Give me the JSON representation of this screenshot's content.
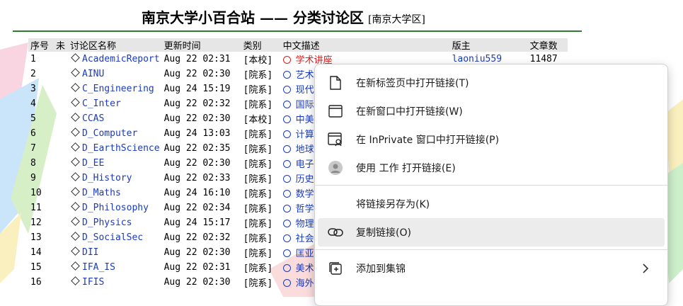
{
  "header": {
    "title": "南京大学小百合站 —— 分类讨论区",
    "subtitle": "[南京大学区]"
  },
  "table": {
    "columns": [
      "序号",
      "未",
      "讨论区名称",
      "更新时间",
      "类别",
      "中文描述",
      "版主",
      "文章数"
    ],
    "rows": [
      {
        "no": "1",
        "name": "AcademicReport",
        "time": "Aug 22 02:31",
        "cat": "[本校]",
        "desc": "学术讲座",
        "owner": "laoniu559",
        "count": "11487",
        "highlight": true
      },
      {
        "no": "2",
        "name": "AINU",
        "time": "Aug 22 02:30",
        "cat": "[院系]",
        "desc": "艺术",
        "owner": "",
        "count": ""
      },
      {
        "no": "3",
        "name": "C_Engineering",
        "time": "Aug 24 15:19",
        "cat": "[院系]",
        "desc": "现代",
        "owner": "",
        "count": ""
      },
      {
        "no": "4",
        "name": "C_Inter",
        "time": "Aug 22 02:32",
        "cat": "[院系]",
        "desc": "国际",
        "owner": "",
        "count": ""
      },
      {
        "no": "5",
        "name": "CCAS",
        "time": "Aug 22 02:30",
        "cat": "[本校]",
        "desc": "中美",
        "owner": "",
        "count": ""
      },
      {
        "no": "6",
        "name": "D_Computer",
        "time": "Aug 24 13:03",
        "cat": "[院系]",
        "desc": "计算",
        "owner": "",
        "count": ""
      },
      {
        "no": "7",
        "name": "D_EarthScience",
        "time": "Aug 22 02:35",
        "cat": "[院系]",
        "desc": "地球",
        "owner": "",
        "count": ""
      },
      {
        "no": "8",
        "name": "D_EE",
        "time": "Aug 22 02:30",
        "cat": "[院系]",
        "desc": "电子",
        "owner": "",
        "count": ""
      },
      {
        "no": "9",
        "name": "D_History",
        "time": "Aug 22 02:33",
        "cat": "[院系]",
        "desc": "历史",
        "owner": "",
        "count": ""
      },
      {
        "no": "10",
        "name": "D_Maths",
        "time": "Aug 24 16:10",
        "cat": "[院系]",
        "desc": "数学",
        "owner": "",
        "count": ""
      },
      {
        "no": "11",
        "name": "D_Philosophy",
        "time": "Aug 22 02:34",
        "cat": "[院系]",
        "desc": "哲学",
        "owner": "",
        "count": ""
      },
      {
        "no": "12",
        "name": "D_Physics",
        "time": "Aug 24 15:17",
        "cat": "[院系]",
        "desc": "物理",
        "owner": "",
        "count": ""
      },
      {
        "no": "13",
        "name": "D_SocialSec",
        "time": "Aug 22 02:32",
        "cat": "[院系]",
        "desc": "社会",
        "owner": "",
        "count": ""
      },
      {
        "no": "14",
        "name": "DII",
        "time": "Aug 22 02:30",
        "cat": "[院系]",
        "desc": "匡亚",
        "owner": "",
        "count": ""
      },
      {
        "no": "15",
        "name": "IFA_IS",
        "time": "Aug 22 02:31",
        "cat": "[院系]",
        "desc": "美术",
        "owner": "",
        "count": ""
      },
      {
        "no": "16",
        "name": "IFIS",
        "time": "Aug 22 02:30",
        "cat": "[院系]",
        "desc": "海外",
        "owner": "",
        "count": ""
      }
    ]
  },
  "context_menu": {
    "items": [
      {
        "label": "在新标签页中打开链接(T)",
        "icon": "new-tab-icon"
      },
      {
        "label": "在新窗口中打开链接(W)",
        "icon": "new-window-icon"
      },
      {
        "label": "在 InPrivate 窗口中打开链接(P)",
        "icon": "inprivate-window-icon"
      },
      {
        "label": "使用 工作 打开链接(E)",
        "icon": "profile-avatar-icon"
      },
      {
        "label": "将链接另存为(K)",
        "icon": ""
      },
      {
        "label": "复制链接(O)",
        "icon": "copy-link-icon"
      },
      {
        "label": "添加到集锦",
        "icon": "collections-add-icon"
      }
    ]
  },
  "colors": {
    "link": "#1a3bbf",
    "highlight": "#d81e1e",
    "rule": "#2e7d32",
    "menu_hover": "#ececec"
  }
}
